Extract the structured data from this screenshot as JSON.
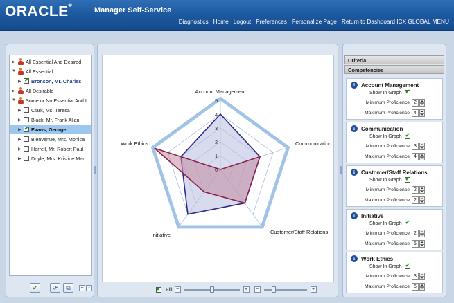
{
  "header": {
    "logo": "ORACLE",
    "logo_mark": "®",
    "title": "Manager Self-Service",
    "links": [
      "Diagnostics",
      "Home",
      "Logout",
      "Preferences",
      "Personalize Page",
      "Return to Dashboard ICX GLOBAL MENU"
    ]
  },
  "tree": {
    "items": [
      {
        "label": "All Essential And Desired"
      },
      {
        "label": "All Essential"
      },
      {
        "label": "Bronson, Mr. Charles"
      },
      {
        "label": "All Desirable"
      },
      {
        "label": "Some or No Essential And I"
      },
      {
        "label": "Clark, Ms. Teresa"
      },
      {
        "label": "Black, Mr. Frank Allan"
      },
      {
        "label": "Evans, George"
      },
      {
        "label": "Bienvenue, Mrs. Monica"
      },
      {
        "label": "Harrell, Mr. Robert Paul"
      },
      {
        "label": "Doyle, Mrs. Kristine Mari"
      }
    ],
    "selected": "Evans, George",
    "checked": [
      "Bronson, Mr. Charles",
      "Evans, George"
    ]
  },
  "left_buttons": {
    "apply_icon": "check-icon",
    "refresh_icon": "refresh-icon",
    "copy_icon": "copy-icon",
    "expand_label": "+",
    "collapse_label": "-"
  },
  "chart_controls": {
    "fill_label": "Fill",
    "minus_label": "−",
    "plus_label": "+",
    "fill_checked": true,
    "zoom_slider_value": 0.5,
    "opacity_slider_value": 0.2
  },
  "chart_data": {
    "type": "radar",
    "axes": [
      "Account Management",
      "Communication",
      "Customer/Staff Relations",
      "Initiative",
      "Work Ethics"
    ],
    "scale_ticks": [
      "0",
      "1",
      "2",
      "3",
      "4",
      "5"
    ],
    "rmax": 5,
    "series": [
      {
        "values": [
          4,
          3,
          3,
          4,
          3
        ],
        "color": "#2c2a86",
        "fill": "#b8bde0"
      },
      {
        "values": [
          0,
          3,
          3,
          2,
          5
        ],
        "color": "#8a2250",
        "fill": "#c58aa3"
      }
    ],
    "outer_ring_color": "#9fc3e6"
  },
  "right_panel": {
    "criteria_label": "Criteria",
    "competencies_label": "Competencies",
    "show_in_graph_label": "Show In Graph",
    "min_label": "Minimum Proficience",
    "max_label": "Maximum Proficience",
    "competencies": [
      {
        "name": "Account Management",
        "show": true,
        "min": "2",
        "max": "4"
      },
      {
        "name": "Communication",
        "show": true,
        "min": "3",
        "max": "4"
      },
      {
        "name": "Customer/Staff Relations",
        "show": true,
        "min": "2",
        "max": "2"
      },
      {
        "name": "Initiative",
        "show": true,
        "min": "2",
        "max": "5"
      },
      {
        "name": "Work Ethics",
        "show": true,
        "min": "3",
        "max": "5"
      }
    ]
  }
}
